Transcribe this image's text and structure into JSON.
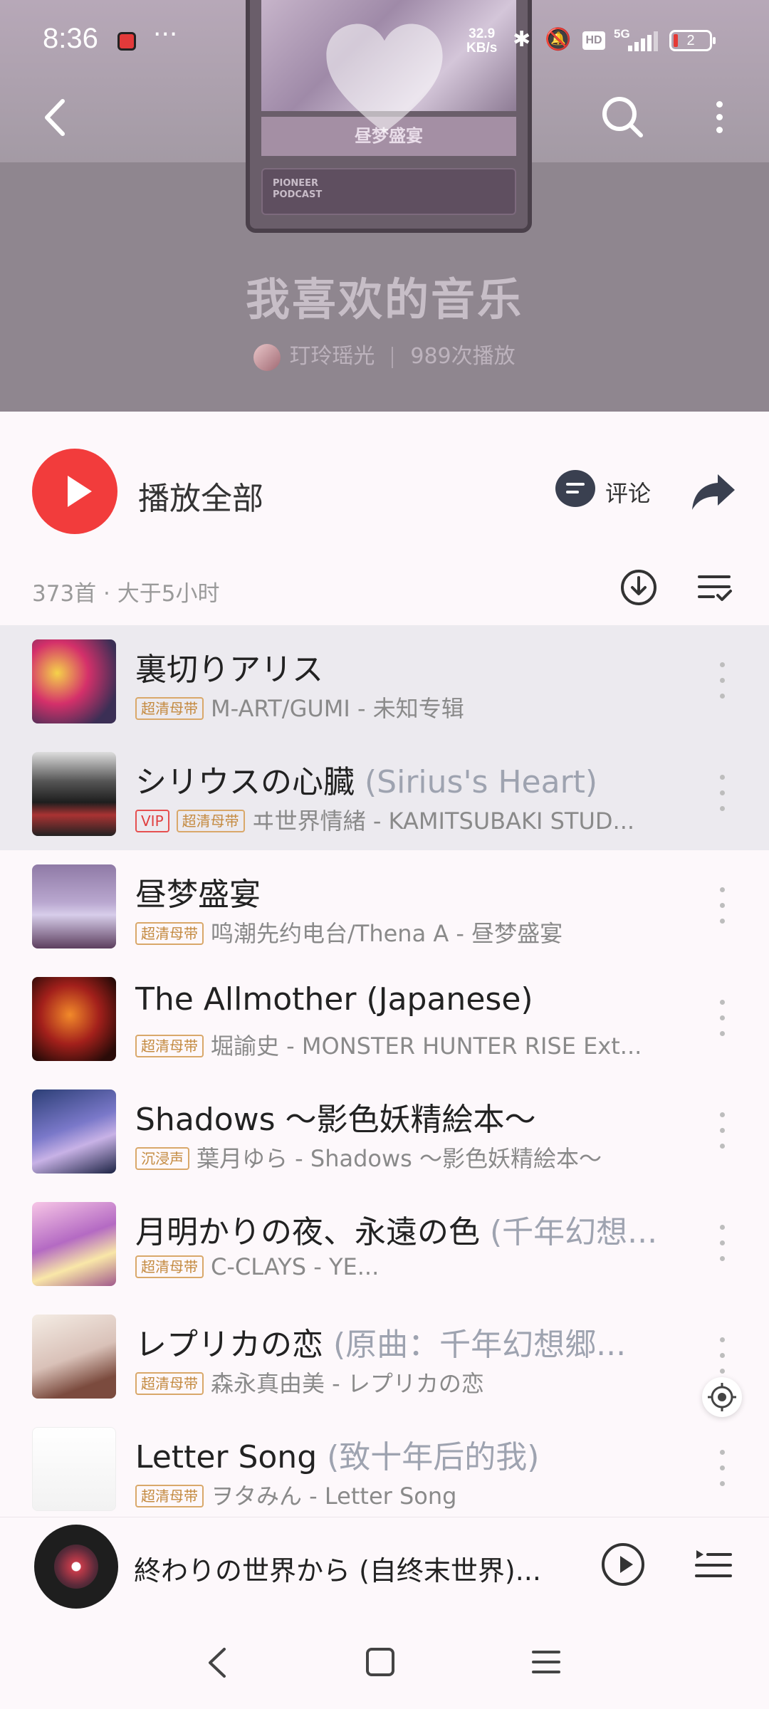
{
  "status_bar": {
    "time": "8:36",
    "dots": "···",
    "net_speed_value": "32.9",
    "net_speed_unit": "KB/s",
    "hd": "HD",
    "network": "5G",
    "battery": "2"
  },
  "header": {
    "cover_text": "昼梦盛宴",
    "cover_brand": "PIONEER PODCAST",
    "playlist_title": "我喜欢的音乐",
    "owner": "玎玲瑶光",
    "play_count": "989次播放"
  },
  "actions": {
    "play_all": "播放全部",
    "comment": "评论"
  },
  "list_info": "373首 · 大于5小时",
  "songs": [
    {
      "title": "裏切りアリス",
      "alt": "",
      "tags": [
        "超清母带"
      ],
      "sub": "M-ART/GUMI - 未知专辑",
      "highlight": true
    },
    {
      "title": "シリウスの心臓",
      "alt": "(Sirius's Heart)",
      "tags": [
        "VIP",
        "超清母带"
      ],
      "sub": "ヰ世界情緒 - KAMITSUBAKI STUD...",
      "highlight": true
    },
    {
      "title": "昼梦盛宴",
      "alt": "",
      "tags": [
        "超清母带"
      ],
      "sub": "鸣潮先约电台/Thena A - 昼梦盛宴",
      "highlight": false
    },
    {
      "title": "The Allmother (Japanese)",
      "alt": "",
      "tags": [
        "超清母带"
      ],
      "sub": "堀諭史 - MONSTER HUNTER RISE Ext...",
      "highlight": false
    },
    {
      "title": "Shadows ～影色妖精絵本～",
      "alt": "",
      "tags": [
        "沉浸声"
      ],
      "sub": "葉月ゆら - Shadows ～影色妖精絵本～",
      "highlight": false
    },
    {
      "title": "月明かりの夜、永遠の色",
      "alt": "(千年幻想...",
      "tags": [
        "超清母带"
      ],
      "sub": "C-CLAYS - YE...",
      "highlight": false
    },
    {
      "title": "レプリカの恋",
      "alt": "(原曲：千年幻想郷...",
      "tags": [
        "超清母带"
      ],
      "sub": "森永真由美 - レプリカの恋",
      "highlight": false
    },
    {
      "title": "Letter Song",
      "alt": "(致十年后的我)",
      "tags": [
        "超清母带"
      ],
      "sub": "ヲタみん - Letter Song",
      "highlight": false
    }
  ],
  "mini_player": {
    "song": "終わりの世界から (自终末世界)..."
  },
  "colors": {
    "accent": "#f23c3c",
    "tag_gold": "#c48a40",
    "tag_vip": "#e04040"
  },
  "icons": [
    "back-icon",
    "search-icon",
    "more-icon",
    "heart-icon",
    "play-icon",
    "comment-icon",
    "share-icon",
    "download-icon",
    "sort-icon",
    "locate-icon",
    "queue-icon"
  ]
}
